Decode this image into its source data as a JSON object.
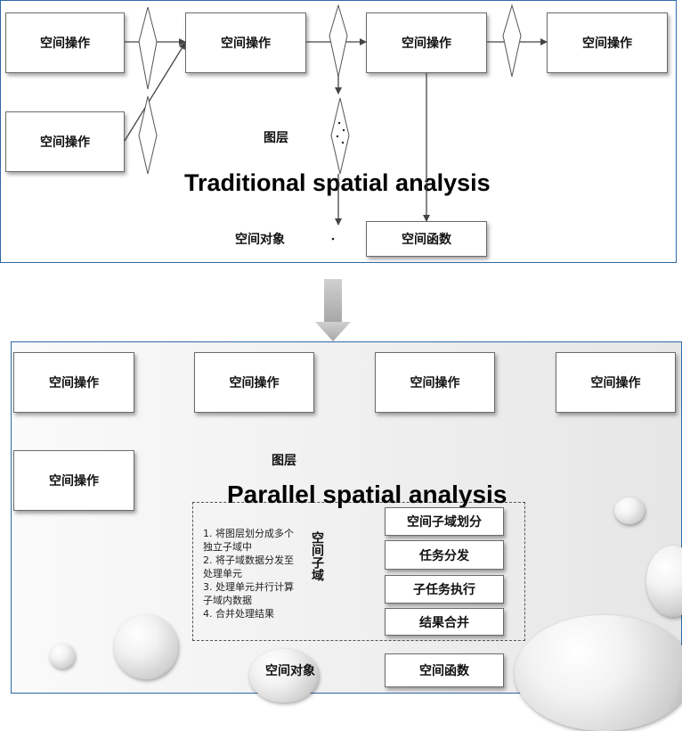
{
  "top": {
    "title": "Traditional spatial analysis",
    "op1": "空间操作",
    "op2": "空间操作",
    "op3": "空间操作",
    "op4": "空间操作",
    "op5": "空间操作",
    "layer": "图层",
    "object": "空间对象",
    "func": "空间函数"
  },
  "bottom": {
    "title": "Parallel spatial analysis",
    "op1": "空间操作",
    "op2": "空间操作",
    "op3": "空间操作",
    "op4": "空间操作",
    "op5": "空间操作",
    "layer": "图层",
    "subdomain": "空间子域",
    "steps": [
      "1. 将图层划分成多个",
      "独立子域中",
      "2. 将子域数据分发至",
      "处理单元",
      "3. 处理单元并行计算",
      "子域内数据",
      "4. 合并处理结果"
    ],
    "stage1": "空间子域划分",
    "stage2": "任务分发",
    "stage3": "子任务执行",
    "stage4": "结果合并",
    "object": "空间对象",
    "func": "空间函数"
  }
}
